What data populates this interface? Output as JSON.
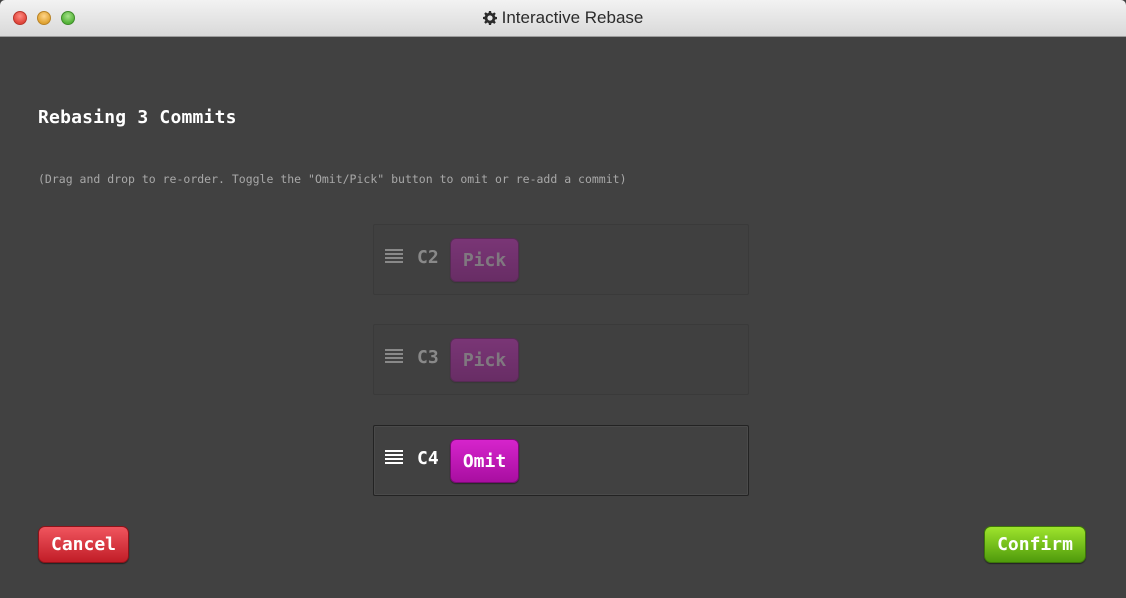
{
  "window": {
    "title": "Interactive Rebase",
    "title_icon": "gear-icon"
  },
  "dialog": {
    "heading": "Rebasing 3 Commits",
    "instructions": "(Drag and drop to re-order. Toggle the \"Omit/Pick\" button to omit or re-add a commit)"
  },
  "commits": [
    {
      "id": "C2",
      "toggle_label": "Pick",
      "state": "omitted"
    },
    {
      "id": "C3",
      "toggle_label": "Pick",
      "state": "omitted"
    },
    {
      "id": "C4",
      "toggle_label": "Omit",
      "state": "picked"
    }
  ],
  "actions": {
    "cancel_label": "Cancel",
    "confirm_label": "Confirm"
  },
  "colors": {
    "background": "#414141",
    "toggle_button": "#c018b8",
    "cancel_button": "#d6323c",
    "confirm_button": "#72c11b"
  }
}
